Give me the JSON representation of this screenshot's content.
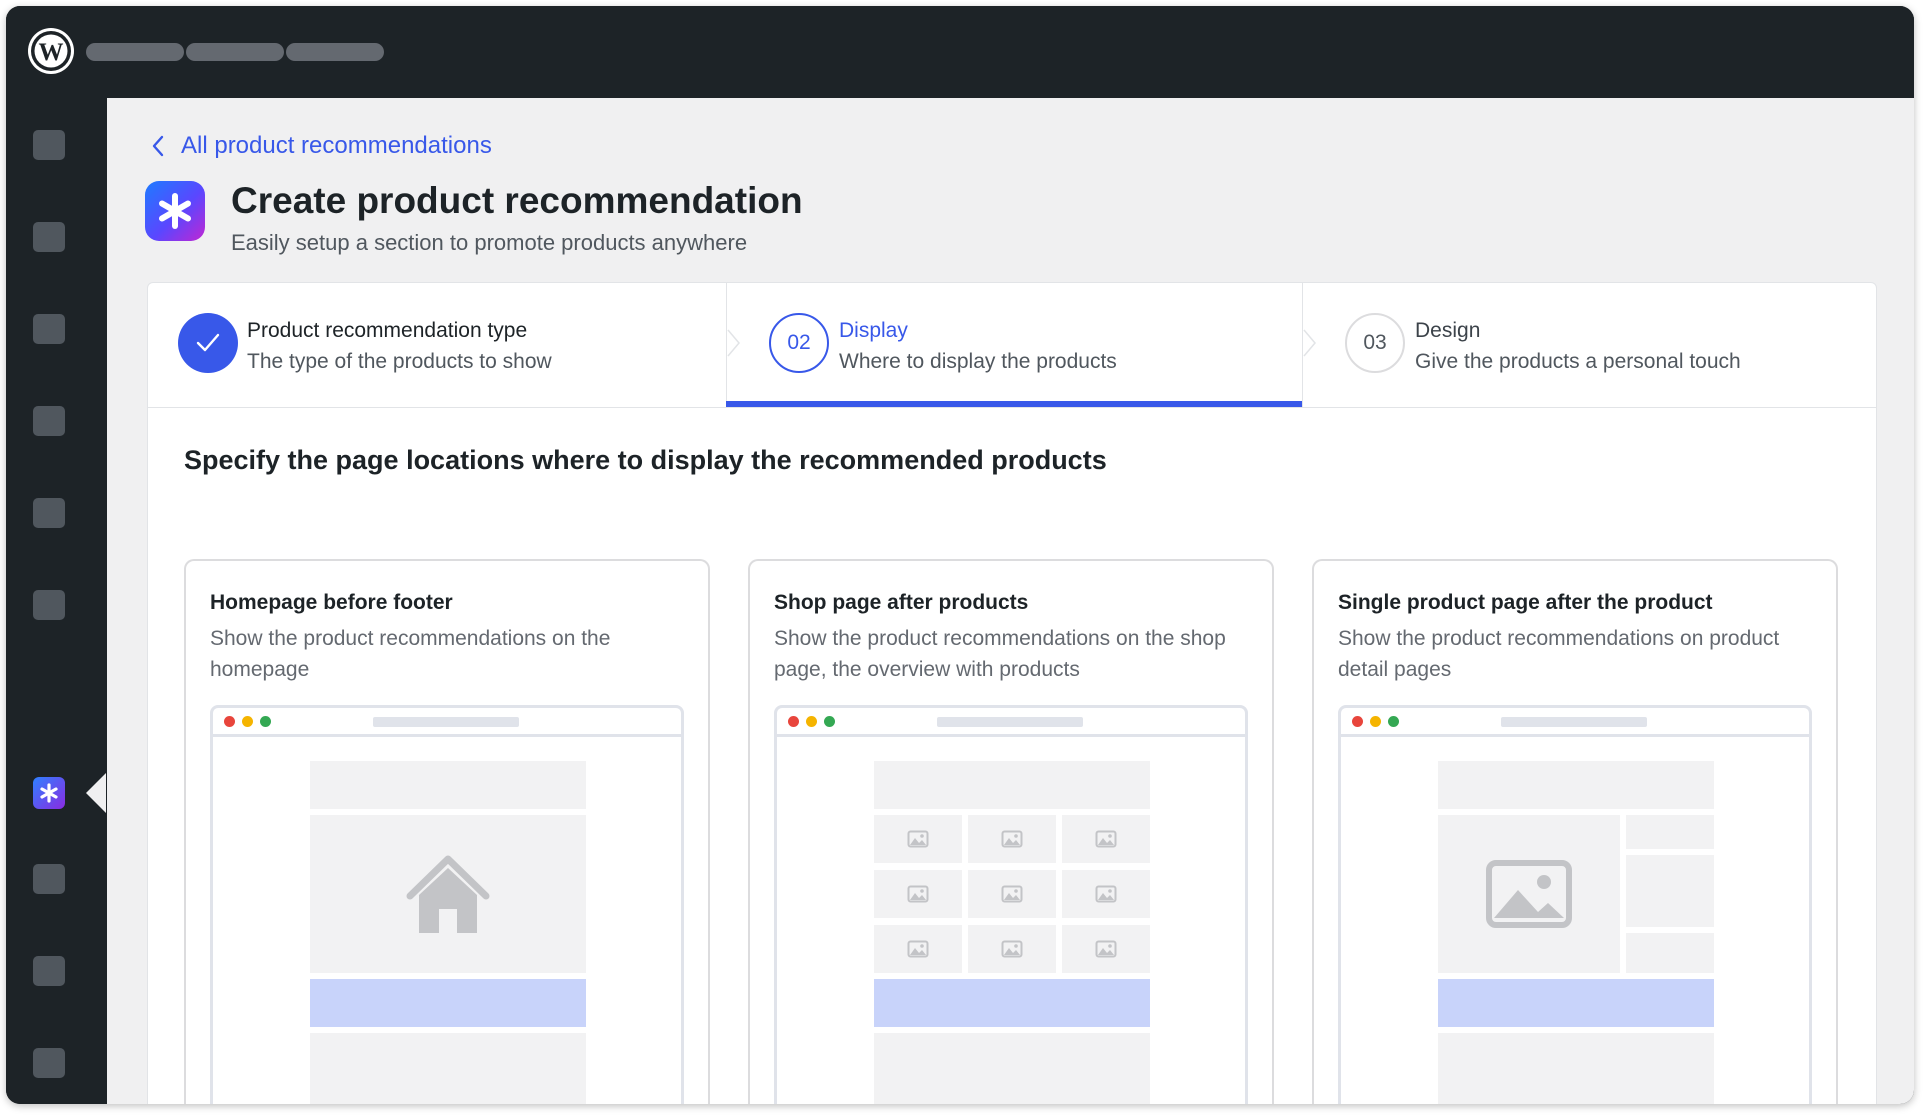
{
  "back_link": {
    "label": "All product recommendations"
  },
  "header": {
    "title": "Create product recommendation",
    "subtitle": "Easily setup a section to promote products anywhere"
  },
  "steps": [
    {
      "number": "",
      "title": "Product recommendation type",
      "description": "The type of the products to show",
      "state": "completed"
    },
    {
      "number": "02",
      "title": "Display",
      "description": "Where to display the products",
      "state": "active"
    },
    {
      "number": "03",
      "title": "Design",
      "description": "Give the products a personal touch",
      "state": "upcoming"
    }
  ],
  "section_heading": "Specify the page locations where to display the recommended products",
  "options": [
    {
      "title": "Homepage before footer",
      "description": "Show the product recommendations on the homepage",
      "icon": "home-icon"
    },
    {
      "title": "Shop page after products",
      "description": "Show the product recommendations on the shop page, the overview with products",
      "icon": "image-grid-icon"
    },
    {
      "title": "Single product page after the product",
      "description": "Show the product recommendations on product detail pages",
      "icon": "image-icon"
    }
  ],
  "colors": {
    "accent": "#3858e9",
    "admin_bar": "#1d2327",
    "highlight_block": "#c8d3fa",
    "dot_red": "#e8453c",
    "dot_yellow": "#f5b400",
    "dot_green": "#34a853"
  }
}
